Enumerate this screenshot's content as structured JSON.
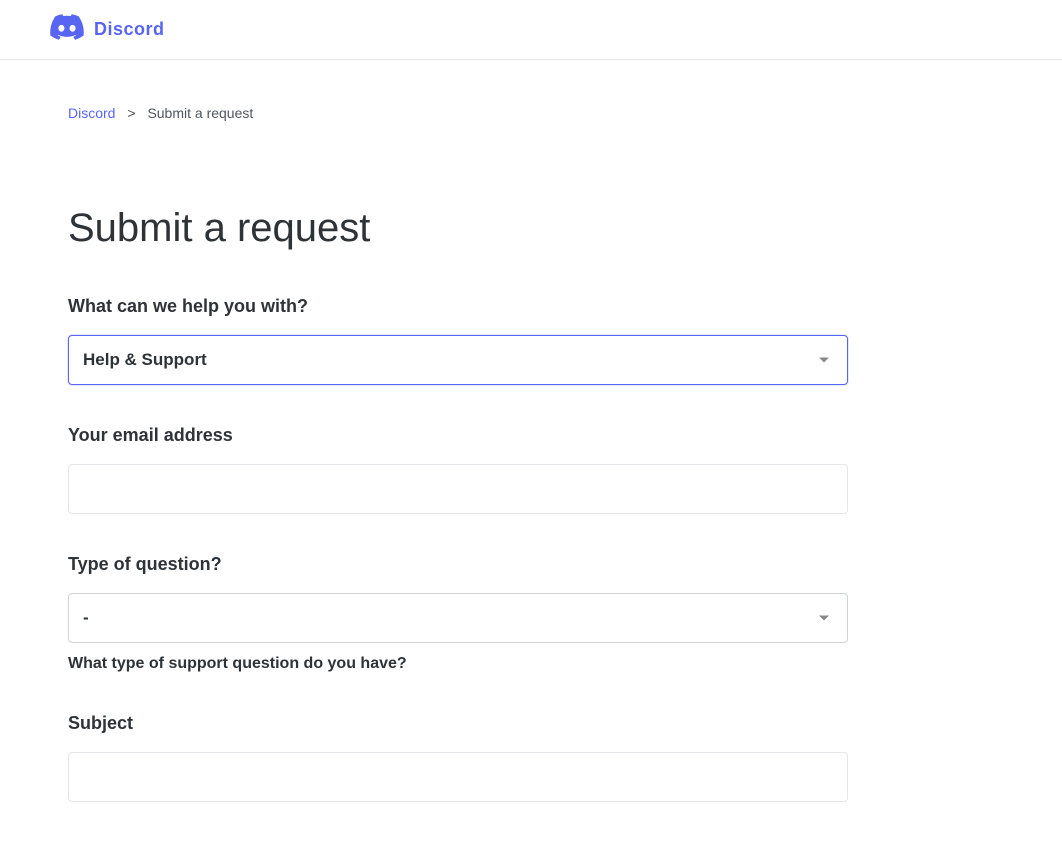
{
  "header": {
    "brand": "Discord"
  },
  "breadcrumb": {
    "root": "Discord",
    "separator": ">",
    "current": "Submit a request"
  },
  "page": {
    "title": "Submit a request"
  },
  "form": {
    "help_with": {
      "label": "What can we help you with?",
      "value": "Help & Support"
    },
    "email": {
      "label": "Your email address",
      "value": ""
    },
    "question_type": {
      "label": "Type of question?",
      "value": "-",
      "hint": "What type of support question do you have?"
    },
    "subject": {
      "label": "Subject",
      "value": ""
    }
  }
}
